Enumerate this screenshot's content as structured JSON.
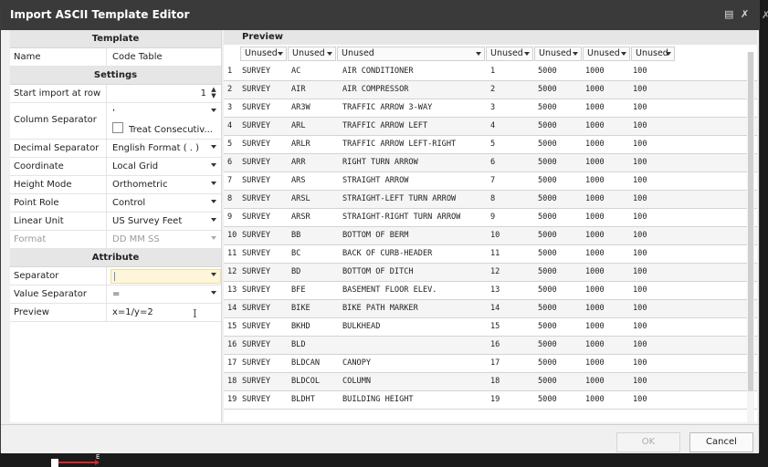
{
  "window": {
    "title": "Import ASCII Template Editor"
  },
  "template": {
    "header": "Template",
    "name_label": "Name",
    "name_value": "Code Table"
  },
  "settings": {
    "header": "Settings",
    "start_row_label": "Start import at row",
    "start_row_value": "1",
    "column_sep_label": "Column Separator",
    "column_sep_value": ",",
    "treat_consecutive_label": "Treat Consecutiv...",
    "decimal_sep_label": "Decimal Separator",
    "decimal_sep_value": "English Format ( . )",
    "coordinate_label": "Coordinate",
    "coordinate_value": "Local Grid",
    "height_mode_label": "Height Mode",
    "height_mode_value": "Orthometric",
    "point_role_label": "Point Role",
    "point_role_value": "Control",
    "linear_unit_label": "Linear Unit",
    "linear_unit_value": "US Survey Feet",
    "format_label": "Format",
    "format_value": "DD MM SS"
  },
  "attribute": {
    "header": "Attribute",
    "separator_label": "Separator",
    "separator_value": "",
    "value_sep_label": "Value Separator",
    "value_sep_value": "=",
    "preview_label": "Preview",
    "preview_value": "x=1/y=2"
  },
  "preview": {
    "header": "Preview",
    "columns": [
      "Unused",
      "Unused",
      "Unused",
      "Unused",
      "Unused",
      "Unused",
      "Unused"
    ],
    "rows": [
      [
        "1",
        "SURVEY",
        "AC",
        "AIR CONDITIONER",
        "1",
        "5000",
        "1000",
        "100"
      ],
      [
        "2",
        "SURVEY",
        "AIR",
        "AIR COMPRESSOR",
        "2",
        "5000",
        "1000",
        "100"
      ],
      [
        "3",
        "SURVEY",
        "AR3W",
        "TRAFFIC ARROW 3-WAY",
        "3",
        "5000",
        "1000",
        "100"
      ],
      [
        "4",
        "SURVEY",
        "ARL",
        "TRAFFIC ARROW LEFT",
        "4",
        "5000",
        "1000",
        "100"
      ],
      [
        "5",
        "SURVEY",
        "ARLR",
        "TRAFFIC ARROW LEFT-RIGHT",
        "5",
        "5000",
        "1000",
        "100"
      ],
      [
        "6",
        "SURVEY",
        "ARR",
        "RIGHT TURN ARROW",
        "6",
        "5000",
        "1000",
        "100"
      ],
      [
        "7",
        "SURVEY",
        "ARS",
        "STRAIGHT ARROW",
        "7",
        "5000",
        "1000",
        "100"
      ],
      [
        "8",
        "SURVEY",
        "ARSL",
        "STRAIGHT-LEFT TURN ARROW",
        "8",
        "5000",
        "1000",
        "100"
      ],
      [
        "9",
        "SURVEY",
        "ARSR",
        "STRAIGHT-RIGHT TURN ARROW",
        "9",
        "5000",
        "1000",
        "100"
      ],
      [
        "10",
        "SURVEY",
        "BB",
        "BOTTOM OF BERM",
        "10",
        "5000",
        "1000",
        "100"
      ],
      [
        "11",
        "SURVEY",
        "BC",
        "BACK OF CURB-HEADER",
        "11",
        "5000",
        "1000",
        "100"
      ],
      [
        "12",
        "SURVEY",
        "BD",
        "BOTTOM OF DITCH",
        "12",
        "5000",
        "1000",
        "100"
      ],
      [
        "13",
        "SURVEY",
        "BFE",
        "BASEMENT FLOOR ELEV.",
        "13",
        "5000",
        "1000",
        "100"
      ],
      [
        "14",
        "SURVEY",
        "BIKE",
        "BIKE PATH MARKER",
        "14",
        "5000",
        "1000",
        "100"
      ],
      [
        "15",
        "SURVEY",
        "BKHD",
        "BULKHEAD",
        "15",
        "5000",
        "1000",
        "100"
      ],
      [
        "16",
        "SURVEY",
        "BLD",
        "",
        "16",
        "5000",
        "1000",
        "100"
      ],
      [
        "17",
        "SURVEY",
        "BLDCAN",
        "CANOPY",
        "17",
        "5000",
        "1000",
        "100"
      ],
      [
        "18",
        "SURVEY",
        "BLDCOL",
        "COLUMN",
        "18",
        "5000",
        "1000",
        "100"
      ],
      [
        "19",
        "SURVEY",
        "BLDHT",
        "BUILDING HEIGHT",
        "19",
        "5000",
        "1000",
        "100"
      ]
    ]
  },
  "footer": {
    "ok_label": "OK",
    "cancel_label": "Cancel"
  },
  "axis": {
    "label": "E"
  },
  "colors": {
    "titlebar": "#3a3a3a",
    "input_highlight": "#fdf6d8",
    "axis_red": "#d8262a"
  }
}
